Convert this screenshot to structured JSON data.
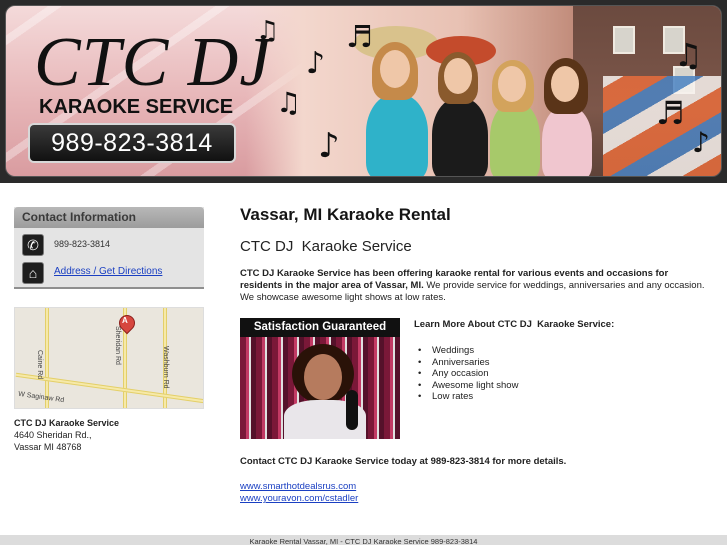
{
  "header": {
    "logo_title": "CTC DJ",
    "logo_subtitle": "KARAOKE SERVICE",
    "phone": "989-823-3814"
  },
  "sidebar": {
    "contact_title": "Contact Information",
    "phone": "989-823-3814",
    "directions_link": "Address / Get Directions",
    "phone_icon": "phone-icon",
    "home_icon": "home-icon",
    "map": {
      "pin_label": "A",
      "roads": [
        "Caine Rd",
        "Sheridan Rd",
        "Washburn Rd",
        "W Saginaw Rd"
      ]
    },
    "address": {
      "name": "CTC DJ Karaoke Service",
      "street": "4640 Sheridan Rd.,",
      "city": "Vassar MI 48768"
    }
  },
  "main": {
    "title": "Vassar, MI Karaoke Rental",
    "subtitle": "CTC DJ  Karaoke Service",
    "intro_bold": "CTC DJ Karaoke Service has been offering karaoke rental for various events and occasions for residents in the major area of Vassar, MI.",
    "intro_rest": " We provide service for weddings, anniversaries and any occasion. We showcase awesome light shows at low rates.",
    "promo_heading": "Satisfaction Guaranteed",
    "learn_more": "Learn More About CTC DJ  Karaoke Service:",
    "features": [
      "Weddings",
      "Anniversaries",
      "Any occasion",
      "Awesome light show",
      "Low rates"
    ],
    "cta": "Contact CTC DJ Karaoke Service today at 989-823-3814 for more details.",
    "links": [
      "www.smarthotdealsrus.com",
      "www.youravon.com/cstadler"
    ]
  },
  "footer": {
    "text": "Karaoke Rental Vassar, MI - CTC DJ Karaoke Service 989-823-3814"
  },
  "colors": {
    "link": "#1a3fc2",
    "sidebar_header": "#a8a8a8",
    "header_bg": "#2a2a2a"
  }
}
